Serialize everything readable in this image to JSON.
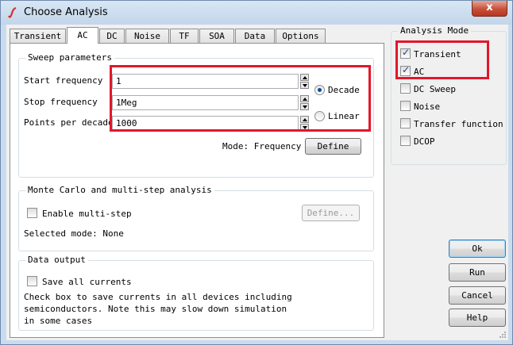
{
  "window": {
    "title": "Choose Analysis",
    "close_glyph": "x"
  },
  "tabs": [
    {
      "label": "Transient",
      "active": false
    },
    {
      "label": "AC",
      "active": true
    },
    {
      "label": "DC",
      "active": false
    },
    {
      "label": "Noise",
      "active": false
    },
    {
      "label": "TF",
      "active": false
    },
    {
      "label": "SOA",
      "active": false
    },
    {
      "label": "Data",
      "active": false
    },
    {
      "label": "Options",
      "active": false
    }
  ],
  "sweep": {
    "legend": "Sweep parameters",
    "start_label": "Start frequency",
    "start_value": "1",
    "stop_label": "Stop frequency",
    "stop_value": "1Meg",
    "points_label": "Points per decade",
    "points_value": "1000",
    "decade_label": "Decade",
    "linear_label": "Linear",
    "selected_scale": "Decade",
    "mode_text": "Mode: Frequency",
    "define_label": "Define"
  },
  "monte_carlo": {
    "legend": "Monte Carlo and multi-step analysis",
    "enable_label": "Enable multi-step",
    "enable_checked": false,
    "define_label": "Define...",
    "selected_mode_text": "Selected mode: None"
  },
  "data_output": {
    "legend": "Data output",
    "save_label": "Save all currents",
    "save_checked": false,
    "help_line1": "Check box to save currents in all devices including",
    "help_line2": "semiconductors. Note this may slow down simulation",
    "help_line3": "in some cases"
  },
  "analysis_mode": {
    "legend": "Analysis Mode",
    "items": [
      {
        "label": "Transient",
        "checked": true
      },
      {
        "label": "AC",
        "checked": true
      },
      {
        "label": "DC Sweep",
        "checked": false
      },
      {
        "label": "Noise",
        "checked": false
      },
      {
        "label": "Transfer function",
        "checked": false
      },
      {
        "label": "DCOP",
        "checked": false
      }
    ]
  },
  "buttons": {
    "ok": "Ok",
    "run": "Run",
    "cancel": "Cancel",
    "help": "Help"
  },
  "colors": {
    "highlight_box": "#e3162a",
    "title_bar": "#c9dced",
    "close_button": "#c7503a"
  },
  "icons": [
    "app-logo-icon",
    "close-icon",
    "radio-icon",
    "checkbox-icon",
    "spin-up-icon",
    "spin-down-icon"
  ]
}
